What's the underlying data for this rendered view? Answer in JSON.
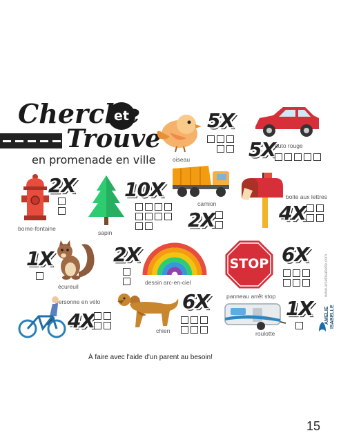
{
  "title": {
    "cherche": "Cherche",
    "et": "et",
    "trouve": "Trouve",
    "subtitle": "en promenade en ville"
  },
  "items": {
    "oiseau": {
      "count": "5X",
      "label": "oiseau"
    },
    "auto": {
      "count": "5X",
      "label": "auto rouge"
    },
    "camion": {
      "count": "2X",
      "label": "camion"
    },
    "boite": {
      "count": "4X",
      "label": "boite aux lettres"
    },
    "borne": {
      "count": "2X",
      "label": "borne-fontaine"
    },
    "sapin": {
      "count": "10X",
      "label": "sapin"
    },
    "ecureuil": {
      "count": "1X",
      "label": "écureuil"
    },
    "arc": {
      "count": "2X",
      "label": "dessin arc-en-ciel"
    },
    "stop": {
      "count": "6X",
      "label": "panneau arrêt stop",
      "sign": "STOP"
    },
    "velo": {
      "count": "4X",
      "label": "personne en vélo"
    },
    "chien": {
      "count": "6X",
      "label": "chien"
    },
    "roulotte": {
      "count": "1X",
      "label": "roulotte"
    }
  },
  "brand": {
    "name1": "AMELIE",
    "name2": "ISABELLE",
    "website": "www.ameliisabelle.com"
  },
  "footer": {
    "note": "À faire avec l'aide d'un parent au besoin!",
    "page_number": "15"
  }
}
